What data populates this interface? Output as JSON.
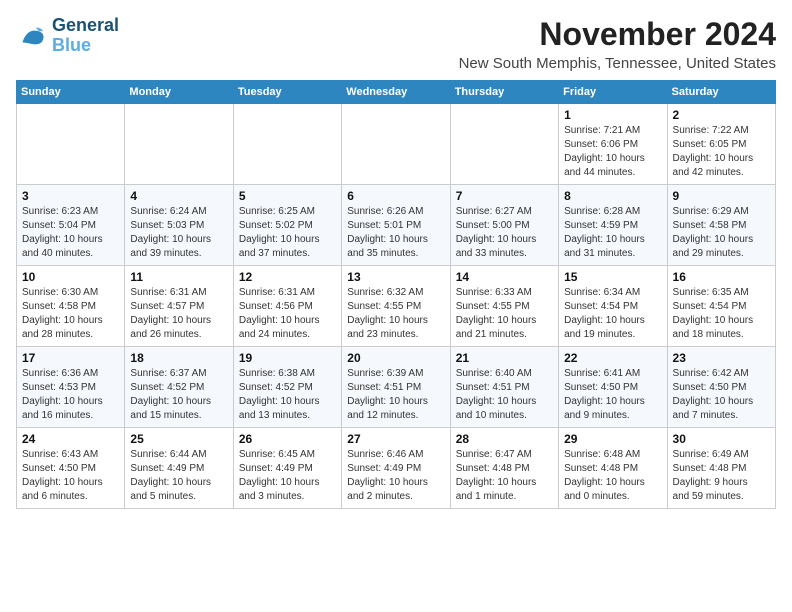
{
  "logo": {
    "line1": "General",
    "line2": "Blue"
  },
  "title": "November 2024",
  "location": "New South Memphis, Tennessee, United States",
  "days_of_week": [
    "Sunday",
    "Monday",
    "Tuesday",
    "Wednesday",
    "Thursday",
    "Friday",
    "Saturday"
  ],
  "weeks": [
    [
      {
        "day": "",
        "detail": ""
      },
      {
        "day": "",
        "detail": ""
      },
      {
        "day": "",
        "detail": ""
      },
      {
        "day": "",
        "detail": ""
      },
      {
        "day": "",
        "detail": ""
      },
      {
        "day": "1",
        "detail": "Sunrise: 7:21 AM\nSunset: 6:06 PM\nDaylight: 10 hours\nand 44 minutes."
      },
      {
        "day": "2",
        "detail": "Sunrise: 7:22 AM\nSunset: 6:05 PM\nDaylight: 10 hours\nand 42 minutes."
      }
    ],
    [
      {
        "day": "3",
        "detail": "Sunrise: 6:23 AM\nSunset: 5:04 PM\nDaylight: 10 hours\nand 40 minutes."
      },
      {
        "day": "4",
        "detail": "Sunrise: 6:24 AM\nSunset: 5:03 PM\nDaylight: 10 hours\nand 39 minutes."
      },
      {
        "day": "5",
        "detail": "Sunrise: 6:25 AM\nSunset: 5:02 PM\nDaylight: 10 hours\nand 37 minutes."
      },
      {
        "day": "6",
        "detail": "Sunrise: 6:26 AM\nSunset: 5:01 PM\nDaylight: 10 hours\nand 35 minutes."
      },
      {
        "day": "7",
        "detail": "Sunrise: 6:27 AM\nSunset: 5:00 PM\nDaylight: 10 hours\nand 33 minutes."
      },
      {
        "day": "8",
        "detail": "Sunrise: 6:28 AM\nSunset: 4:59 PM\nDaylight: 10 hours\nand 31 minutes."
      },
      {
        "day": "9",
        "detail": "Sunrise: 6:29 AM\nSunset: 4:58 PM\nDaylight: 10 hours\nand 29 minutes."
      }
    ],
    [
      {
        "day": "10",
        "detail": "Sunrise: 6:30 AM\nSunset: 4:58 PM\nDaylight: 10 hours\nand 28 minutes."
      },
      {
        "day": "11",
        "detail": "Sunrise: 6:31 AM\nSunset: 4:57 PM\nDaylight: 10 hours\nand 26 minutes."
      },
      {
        "day": "12",
        "detail": "Sunrise: 6:31 AM\nSunset: 4:56 PM\nDaylight: 10 hours\nand 24 minutes."
      },
      {
        "day": "13",
        "detail": "Sunrise: 6:32 AM\nSunset: 4:55 PM\nDaylight: 10 hours\nand 23 minutes."
      },
      {
        "day": "14",
        "detail": "Sunrise: 6:33 AM\nSunset: 4:55 PM\nDaylight: 10 hours\nand 21 minutes."
      },
      {
        "day": "15",
        "detail": "Sunrise: 6:34 AM\nSunset: 4:54 PM\nDaylight: 10 hours\nand 19 minutes."
      },
      {
        "day": "16",
        "detail": "Sunrise: 6:35 AM\nSunset: 4:54 PM\nDaylight: 10 hours\nand 18 minutes."
      }
    ],
    [
      {
        "day": "17",
        "detail": "Sunrise: 6:36 AM\nSunset: 4:53 PM\nDaylight: 10 hours\nand 16 minutes."
      },
      {
        "day": "18",
        "detail": "Sunrise: 6:37 AM\nSunset: 4:52 PM\nDaylight: 10 hours\nand 15 minutes."
      },
      {
        "day": "19",
        "detail": "Sunrise: 6:38 AM\nSunset: 4:52 PM\nDaylight: 10 hours\nand 13 minutes."
      },
      {
        "day": "20",
        "detail": "Sunrise: 6:39 AM\nSunset: 4:51 PM\nDaylight: 10 hours\nand 12 minutes."
      },
      {
        "day": "21",
        "detail": "Sunrise: 6:40 AM\nSunset: 4:51 PM\nDaylight: 10 hours\nand 10 minutes."
      },
      {
        "day": "22",
        "detail": "Sunrise: 6:41 AM\nSunset: 4:50 PM\nDaylight: 10 hours\nand 9 minutes."
      },
      {
        "day": "23",
        "detail": "Sunrise: 6:42 AM\nSunset: 4:50 PM\nDaylight: 10 hours\nand 7 minutes."
      }
    ],
    [
      {
        "day": "24",
        "detail": "Sunrise: 6:43 AM\nSunset: 4:50 PM\nDaylight: 10 hours\nand 6 minutes."
      },
      {
        "day": "25",
        "detail": "Sunrise: 6:44 AM\nSunset: 4:49 PM\nDaylight: 10 hours\nand 5 minutes."
      },
      {
        "day": "26",
        "detail": "Sunrise: 6:45 AM\nSunset: 4:49 PM\nDaylight: 10 hours\nand 3 minutes."
      },
      {
        "day": "27",
        "detail": "Sunrise: 6:46 AM\nSunset: 4:49 PM\nDaylight: 10 hours\nand 2 minutes."
      },
      {
        "day": "28",
        "detail": "Sunrise: 6:47 AM\nSunset: 4:48 PM\nDaylight: 10 hours\nand 1 minute."
      },
      {
        "day": "29",
        "detail": "Sunrise: 6:48 AM\nSunset: 4:48 PM\nDaylight: 10 hours\nand 0 minutes."
      },
      {
        "day": "30",
        "detail": "Sunrise: 6:49 AM\nSunset: 4:48 PM\nDaylight: 9 hours\nand 59 minutes."
      }
    ]
  ]
}
